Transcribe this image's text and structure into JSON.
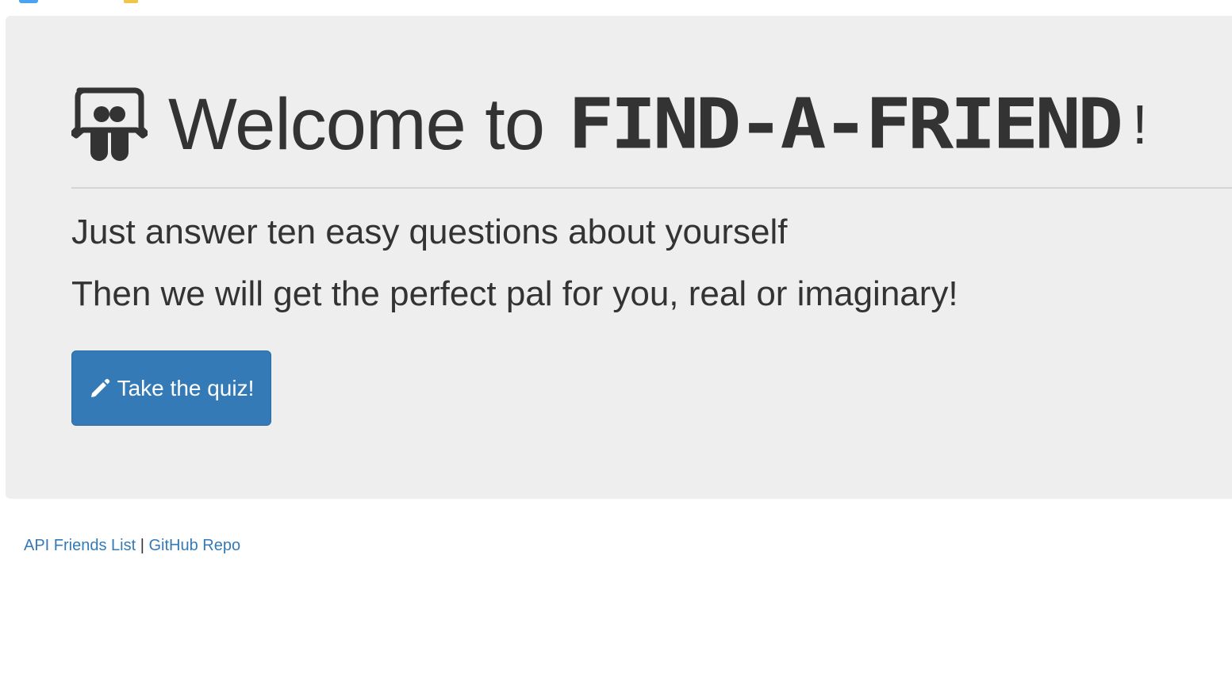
{
  "header": {
    "welcome": "Welcome to",
    "brand": "Find-A-Friend",
    "exclamation": "!",
    "logo_icon": "slideshare-icon"
  },
  "lead": {
    "line1": "Just answer ten easy questions about yourself",
    "line2": "Then we will get the perfect pal for you, real or imaginary!"
  },
  "quiz_button": {
    "label": "Take the quiz!",
    "icon": "pencil-icon"
  },
  "footer": {
    "api_link": "API Friends List",
    "separator": "|",
    "github_link": "GitHub Repo"
  },
  "colors": {
    "jumbotron_bg": "#eeeeee",
    "primary": "#337ab7",
    "text": "#333333"
  }
}
